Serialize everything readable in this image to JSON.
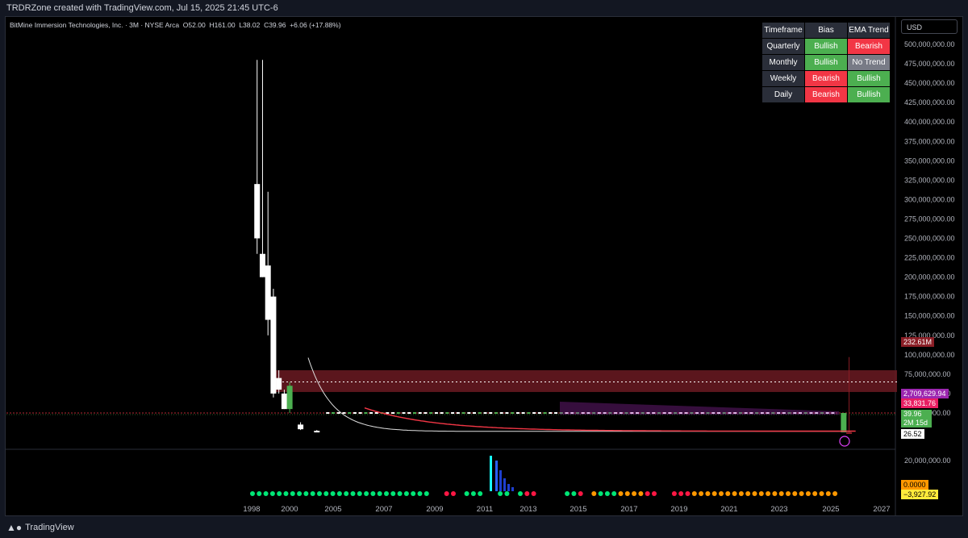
{
  "header": {
    "attribution": "TRDRZone created with TradingView.com, Jul 15, 2025 21:45 UTC-6"
  },
  "legend": {
    "symbol": "BitMine Immersion Technologies, Inc. · 3M · NYSE Arca",
    "open_label": "O",
    "open": "52.00",
    "high_label": "H",
    "high": "161.00",
    "low_label": "L",
    "low": "38.02",
    "close_label": "C",
    "close": "39.96",
    "change": "+6.06 (+17.88%)"
  },
  "currency": "USD",
  "ema_table": {
    "headers": [
      "Timeframe",
      "Bias",
      "EMA Trend"
    ],
    "rows": [
      {
        "tf": "Quarterly",
        "bias": "Bullish",
        "bias_state": "bull",
        "trend": "Bearish",
        "trend_state": "bear"
      },
      {
        "tf": "Monthly",
        "bias": "Bullish",
        "bias_state": "bull",
        "trend": "No Trend",
        "trend_state": "none"
      },
      {
        "tf": "Weekly",
        "bias": "Bearish",
        "bias_state": "bear",
        "trend": "Bullish",
        "trend_state": "bull"
      },
      {
        "tf": "Daily",
        "bias": "Bearish",
        "bias_state": "bear",
        "trend": "Bullish",
        "trend_state": "bull"
      }
    ]
  },
  "price_labels": {
    "top_red": "232.61M",
    "purple": "2,709,629.94",
    "pink": "33,831.76",
    "close": "39.96",
    "countdown": "2M 15d",
    "low": "26.52"
  },
  "osc_labels": {
    "zero": "0.0000",
    "value": "−3,927.92"
  },
  "footer": {
    "brand": "TradingView"
  },
  "colors": {
    "bull": "#4caf50",
    "bear": "#f23645",
    "band": "#6b1a22",
    "purple": "#9c27b0"
  },
  "chart_data": {
    "type": "candlestick",
    "y_axis": {
      "min": 0,
      "max": 500000000,
      "step": 25000000,
      "tick_labels": [
        "500,000,000.00",
        "475,000,000.00",
        "450,000,000.00",
        "425,000,000.00",
        "400,000,000.00",
        "375,000,000.00",
        "350,000,000.00",
        "325,000,000.00",
        "300,000,000.00",
        "275,000,000.00",
        "250,000,000.00",
        "225,000,000.00",
        "200,000,000.00",
        "175,000,000.00",
        "150,000,000.00",
        "125,000,000.00",
        "100,000,000.00",
        "75,000,000.00",
        "50,000,000.00",
        "25,000,000.00"
      ]
    },
    "osc_axis_label": "20,000,000.00",
    "x_tick_labels": [
      "1998",
      "2000",
      "2005",
      "2007",
      "2009",
      "2011",
      "2013",
      "2015",
      "2017",
      "2019",
      "2021",
      "2023",
      "2025",
      "2027"
    ],
    "candles": [
      {
        "year": 1998.25,
        "open": 250000000,
        "high": 480000000,
        "low": 230000000,
        "close": 320000000,
        "dir": "down"
      },
      {
        "year": 1998.5,
        "open": 230000000,
        "high": 480000000,
        "low": 200000000,
        "close": 200000000,
        "dir": "down"
      },
      {
        "year": 1998.75,
        "open": 215000000,
        "high": 310000000,
        "low": 125000000,
        "close": 145000000,
        "dir": "down"
      },
      {
        "year": 1999.0,
        "open": 175000000,
        "high": 185000000,
        "low": 45000000,
        "close": 50000000,
        "dir": "down"
      },
      {
        "year": 1999.25,
        "open": 70000000,
        "high": 80000000,
        "low": 50000000,
        "close": 55000000,
        "dir": "down"
      },
      {
        "year": 1999.5,
        "open": 50000000,
        "high": 55000000,
        "low": 30000000,
        "close": 30000000,
        "dir": "down"
      },
      {
        "year": 1999.75,
        "open": 30000000,
        "high": 65000000,
        "low": 25000000,
        "close": 60000000,
        "dir": "up"
      },
      {
        "year": 2000.25,
        "open": 10000000,
        "high": 13000000,
        "low": 3000000,
        "close": 4000000,
        "dir": "down"
      },
      {
        "year": 2001.0,
        "open": 2000000,
        "high": 3000000,
        "low": 500000,
        "close": 1000000,
        "dir": "down"
      },
      {
        "year": 2025.25,
        "open": 0,
        "high": 25000000,
        "low": 0,
        "close": 25000000,
        "dir": "up"
      },
      {
        "year": 2025.5,
        "open": 52,
        "high": 97000000,
        "low": 38,
        "close": 40,
        "dir": "down"
      }
    ],
    "supply_zone": {
      "from": 52000000,
      "to": 80000000
    },
    "dotted_level": 65000000,
    "ema_curves": [
      "white",
      "red"
    ],
    "oscillator": {
      "dots": "green/red/orange sequence per bar",
      "histogram_peak_year": 2011.5
    }
  }
}
